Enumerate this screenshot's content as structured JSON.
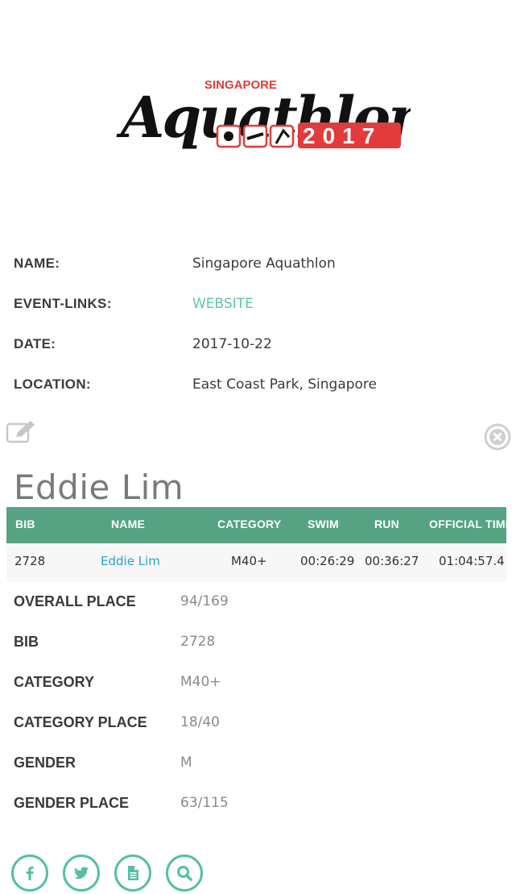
{
  "logo": {
    "line1": "SINGAPORE",
    "line2": "Aquathlon",
    "year": "2017",
    "colors": {
      "script": "#111111",
      "accent": "#e23b3b"
    }
  },
  "event": {
    "rows": [
      {
        "label": "NAME:",
        "value": "Singapore Aquathlon"
      },
      {
        "label": "EVENT-LINKS:",
        "value": "WEBSITE"
      },
      {
        "label": "DATE:",
        "value": "2017-10-22"
      },
      {
        "label": "LOCATION:",
        "value": "East Coast Park, Singapore"
      }
    ]
  },
  "result": {
    "athlete_name": "Eddie Lim",
    "icons": {
      "edit": "edit-icon",
      "close": "close-icon"
    },
    "table": {
      "headers": [
        "BIB",
        "NAME",
        "CATEGORY",
        "SWIM",
        "RUN",
        "OFFICIAL TIME"
      ],
      "row": [
        "2728",
        "Eddie Lim",
        "M40+",
        "00:26:29",
        "00:36:27",
        "01:04:57.4"
      ]
    },
    "details": [
      {
        "label": "OVERALL PLACE",
        "value": "94/169"
      },
      {
        "label": "BIB",
        "value": "2728"
      },
      {
        "label": "CATEGORY",
        "value": "M40+"
      },
      {
        "label": "CATEGORY PLACE",
        "value": "18/40"
      },
      {
        "label": "GENDER",
        "value": "M"
      },
      {
        "label": "GENDER PLACE",
        "value": "63/115"
      }
    ],
    "share": [
      "facebook-icon",
      "twitter-icon",
      "document-icon",
      "search-icon"
    ]
  },
  "colors": {
    "header_bg": "#55a383",
    "link": "#5fc4a6",
    "name_link": "#2a9fcf",
    "share_ring": "#55bfa3"
  }
}
